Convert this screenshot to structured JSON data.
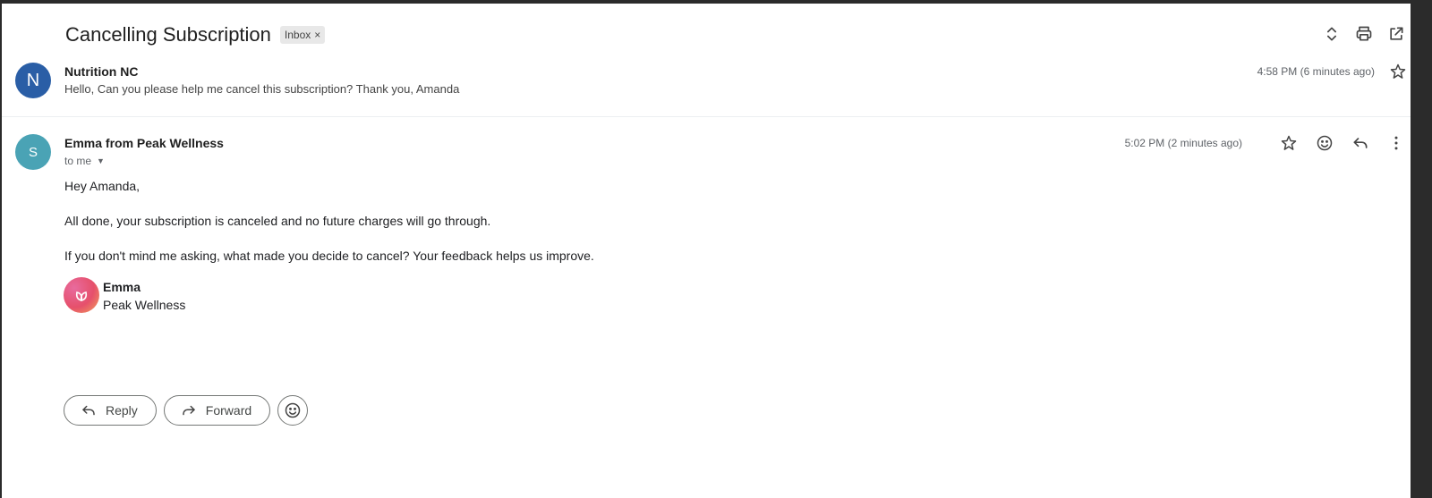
{
  "subject": "Cancelling Subscription",
  "label": {
    "name": "Inbox",
    "remove": "×"
  },
  "messages": [
    {
      "avatar_letter": "N",
      "avatar_color": "#2a5ea6",
      "sender": "Nutrition NC",
      "snippet": "Hello, Can you please help me cancel this subscription? Thank you, Amanda",
      "time": "4:58 PM (6 minutes ago)"
    },
    {
      "avatar_letter": "S",
      "avatar_color": "#4aa3b5",
      "sender": "Emma from Peak Wellness",
      "to": "to me",
      "time": "5:02 PM (2 minutes ago)",
      "body": [
        "Hey Amanda,",
        "All done, your subscription is canceled and no future charges will go through.",
        "If you don't mind me asking, what made you decide to cancel? Your feedback helps us improve."
      ],
      "signature": {
        "name": "Emma",
        "company": "Peak Wellness"
      }
    }
  ],
  "footer": {
    "reply_label": "Reply",
    "forward_label": "Forward"
  },
  "icons": {
    "top": [
      "expand-collapse-icon",
      "print-icon",
      "open-in-new-window-icon"
    ],
    "message": [
      "star-icon",
      "emoji-react-icon",
      "reply-icon",
      "more-options-icon"
    ]
  }
}
